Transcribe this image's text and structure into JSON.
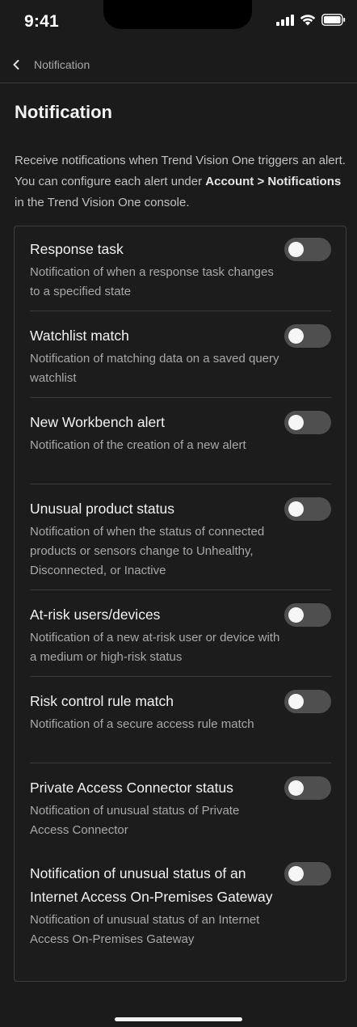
{
  "status_bar": {
    "time": "9:41"
  },
  "nav": {
    "back_label": "Notification"
  },
  "page": {
    "title": "Notification",
    "description_part1": "Receive notifications when Trend Vision One triggers an alert. You can configure each alert under ",
    "description_bold": "Account > Notifications",
    "description_part2": " in the Trend Vision One console."
  },
  "settings": [
    {
      "title": "Response task",
      "description": "Notification of when a response task changes to a specified state",
      "enabled": false
    },
    {
      "title": "Watchlist match",
      "description": "Notification of matching data on a saved query watchlist",
      "enabled": false
    },
    {
      "title": "New Workbench alert",
      "description": "Notification of the creation of a new alert",
      "enabled": false
    },
    {
      "title": "Unusual product status",
      "description": "Notification of when the status of connected products or sensors change to Unhealthy, Disconnected, or Inactive",
      "enabled": false
    },
    {
      "title": "At-risk users/devices",
      "description": "Notification of a new at-risk user or device with a medium or high-risk status",
      "enabled": false
    },
    {
      "title": "Risk control rule match",
      "description": "Notification of a secure access rule match",
      "enabled": false
    },
    {
      "title": "Private Access Connector status",
      "description": "Notification of unusual status of Private Access Connector",
      "enabled": false
    },
    {
      "title": "Notification of unusual status of an Internet Access On-Premises Gateway",
      "description": "Notification of unusual status of an Internet Access On-Premises Gateway",
      "enabled": false
    }
  ],
  "colors": {
    "background": "#1b1b1b",
    "toggle_off": "#4f4f4f",
    "knob": "#f6f6f6"
  }
}
